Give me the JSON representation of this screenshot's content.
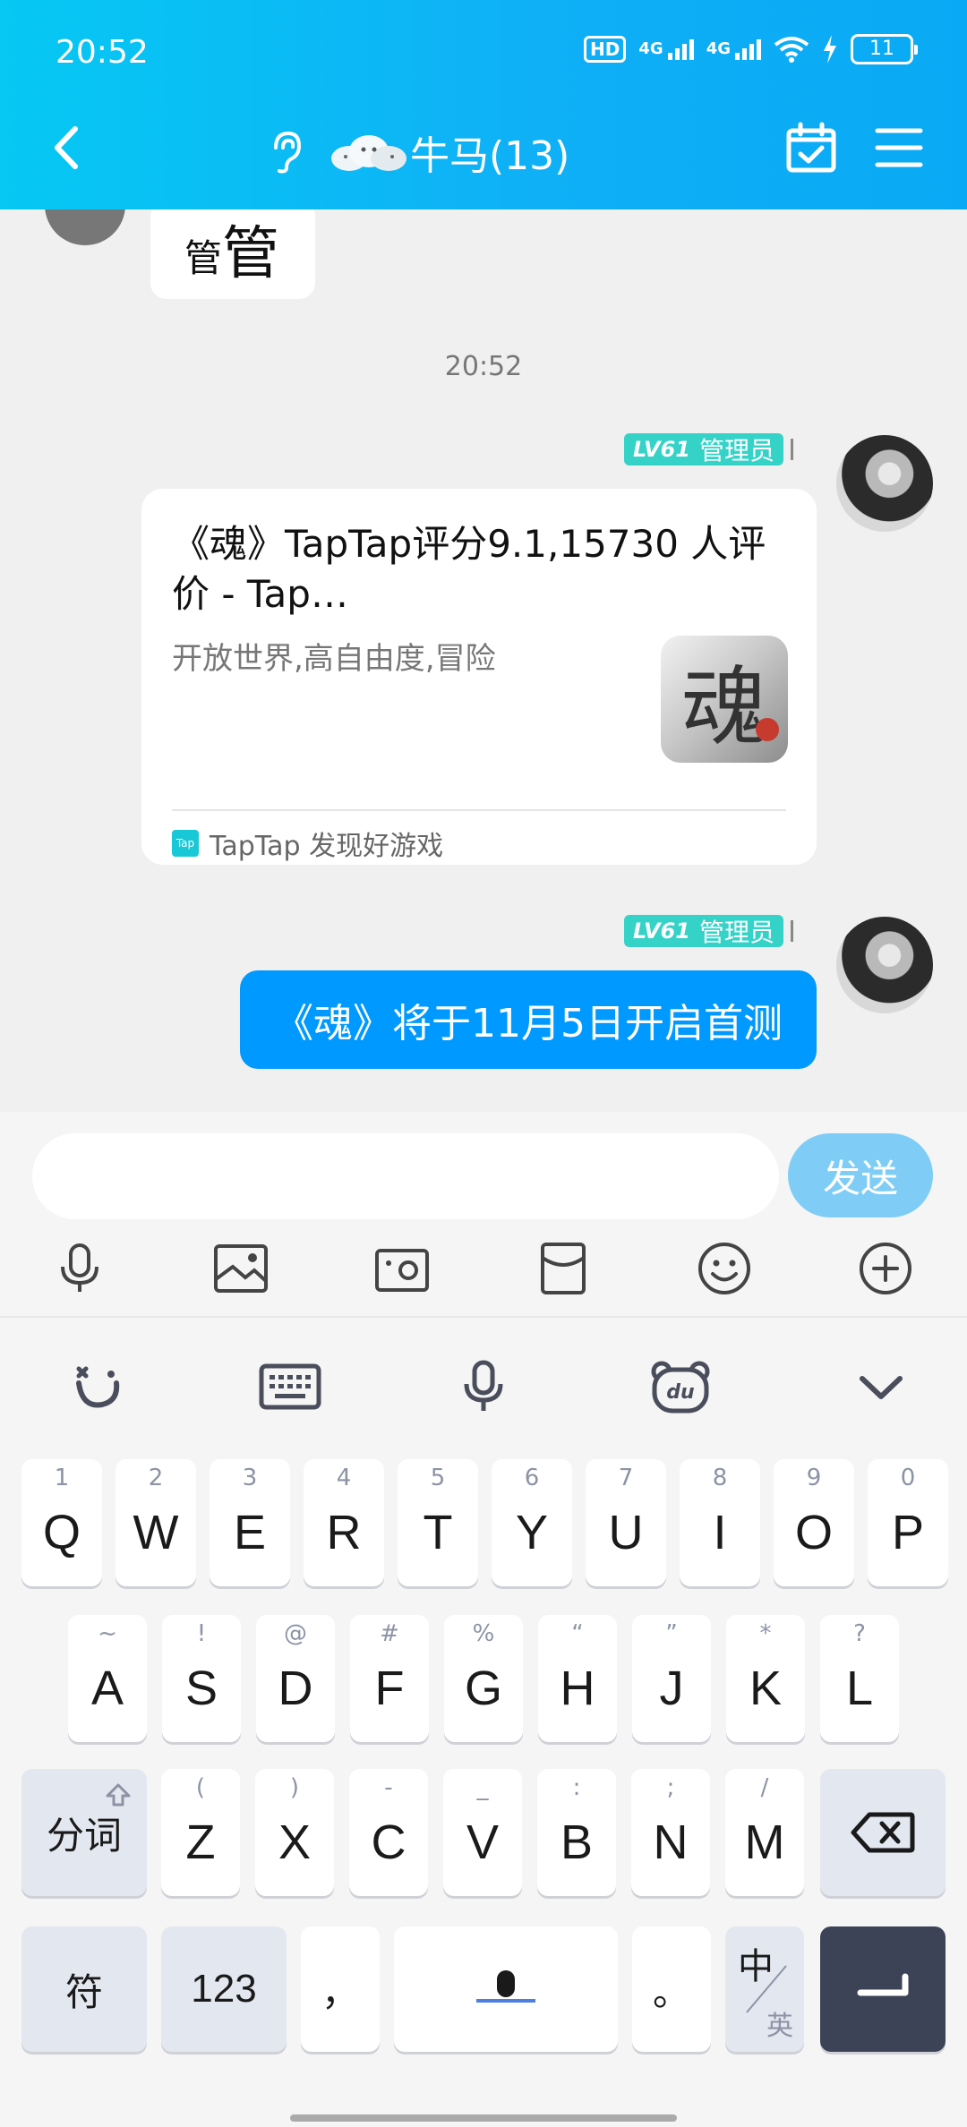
{
  "status_bar": {
    "time": "20:52",
    "hd": "HD",
    "net1": "4G",
    "net2": "4G",
    "battery": "11"
  },
  "header": {
    "title": "牛马(13)",
    "icons": [
      "back-icon",
      "ear-icon",
      "group-avatar",
      "calendar-check-icon",
      "menu-icon"
    ]
  },
  "chat": {
    "prev_bubble_small": "管",
    "prev_bubble_big": "管",
    "timestamp": "20:52",
    "messages": [
      {
        "badge_level": "LV61",
        "badge_role": "管理员",
        "card": {
          "title": "《魂》TapTap评分9.1,15730 人评价 - Tap…",
          "description": "开放世界,高自由度,冒险",
          "thumb_glyph": "魂",
          "source_icon": "Tap",
          "source": "TapTap 发现好游戏"
        }
      },
      {
        "badge_level": "LV61",
        "badge_role": "管理员",
        "text": "《魂》将于11月5日开启首测"
      }
    ]
  },
  "input": {
    "value": "",
    "placeholder": "",
    "send_label": "发送",
    "toolbar_icons": [
      "microphone-icon",
      "image-icon",
      "camera-icon",
      "red-packet-icon",
      "emoji-icon",
      "plus-icon"
    ]
  },
  "keyboard": {
    "toolbar_icons": [
      "smile-logo-icon",
      "keyboard-icon",
      "mic-icon",
      "du-bear-icon",
      "collapse-icon"
    ],
    "row1": [
      {
        "k": "Q",
        "s": "1"
      },
      {
        "k": "W",
        "s": "2"
      },
      {
        "k": "E",
        "s": "3"
      },
      {
        "k": "R",
        "s": "4"
      },
      {
        "k": "T",
        "s": "5"
      },
      {
        "k": "Y",
        "s": "6"
      },
      {
        "k": "U",
        "s": "7"
      },
      {
        "k": "I",
        "s": "8"
      },
      {
        "k": "O",
        "s": "9"
      },
      {
        "k": "P",
        "s": "0"
      }
    ],
    "row2": [
      {
        "k": "A",
        "s": "~"
      },
      {
        "k": "S",
        "s": "!"
      },
      {
        "k": "D",
        "s": "@"
      },
      {
        "k": "F",
        "s": "#"
      },
      {
        "k": "G",
        "s": "%"
      },
      {
        "k": "H",
        "s": "“"
      },
      {
        "k": "J",
        "s": "”"
      },
      {
        "k": "K",
        "s": "*"
      },
      {
        "k": "L",
        "s": "?"
      }
    ],
    "row3": [
      {
        "k": "Z",
        "s": "("
      },
      {
        "k": "X",
        "s": ")"
      },
      {
        "k": "C",
        "s": "-"
      },
      {
        "k": "V",
        "s": "_"
      },
      {
        "k": "B",
        "s": ":"
      },
      {
        "k": "N",
        "s": ";"
      },
      {
        "k": "M",
        "s": "/"
      }
    ],
    "fenci_label": "分词",
    "symbol_label": "符",
    "number_label": "123",
    "comma_label": "，",
    "period_label": "。",
    "switch_zh": "中",
    "switch_en": "英"
  },
  "colors": {
    "header": "#0fb0f6",
    "bubble": "#0099ff",
    "badge": "#35d2c8",
    "send": "#7fcdf7",
    "enter_key": "#3c4357"
  }
}
